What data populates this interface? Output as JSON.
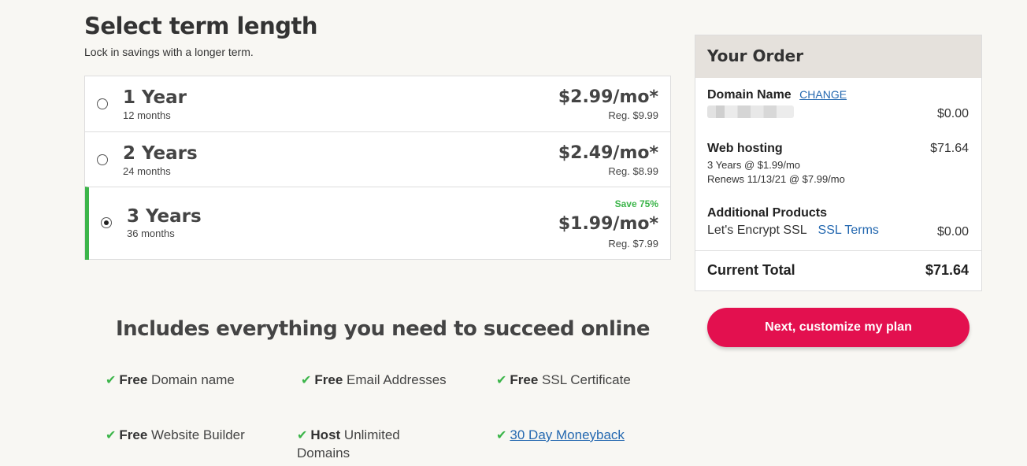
{
  "page": {
    "title": "Select term length",
    "subtitle": "Lock in savings with a longer term."
  },
  "terms": [
    {
      "name": "1 Year",
      "months": "12 months",
      "price": "$2.99/mo*",
      "regular": "Reg. $9.99",
      "selected": false
    },
    {
      "name": "2 Years",
      "months": "24 months",
      "price": "$2.49/mo*",
      "regular": "Reg. $8.99",
      "selected": false
    },
    {
      "name": "3 Years",
      "months": "36 months",
      "price": "$1.99/mo*",
      "regular": "Reg. $7.99",
      "save": "Save 75%",
      "selected": true
    }
  ],
  "includes": {
    "title": "Includes everything you need to succeed online",
    "features": [
      {
        "bold": "Free",
        "text": " Domain name"
      },
      {
        "bold": "Free",
        "text": " Email Addresses"
      },
      {
        "bold": "Free",
        "text": " SSL Certificate"
      },
      {
        "bold": "Free",
        "text": " Website Builder"
      },
      {
        "bold": "Host",
        "text": " Unlimited Domains"
      },
      {
        "link": "30 Day Moneyback"
      }
    ]
  },
  "order": {
    "title": "Your Order",
    "domain": {
      "label": "Domain Name",
      "change": "CHANGE",
      "amount": "$0.00"
    },
    "hosting": {
      "label": "Web hosting",
      "amount": "$71.64",
      "line1": "3 Years @ $1.99/mo",
      "line2": "Renews 11/13/21 @ $7.99/mo"
    },
    "additional": {
      "label": "Additional Products",
      "item": "Let's Encrypt SSL",
      "terms_link": "SSL Terms",
      "amount": "$0.00"
    },
    "total": {
      "label": "Current Total",
      "amount": "$71.64"
    }
  },
  "cta": {
    "label": "Next, customize my plan"
  },
  "colors": {
    "accent": "#e3104f",
    "success": "#3cb54a",
    "link": "#2468b0",
    "header_bg": "#e5e1dc"
  },
  "icons": {
    "feature_check": "check-icon"
  }
}
